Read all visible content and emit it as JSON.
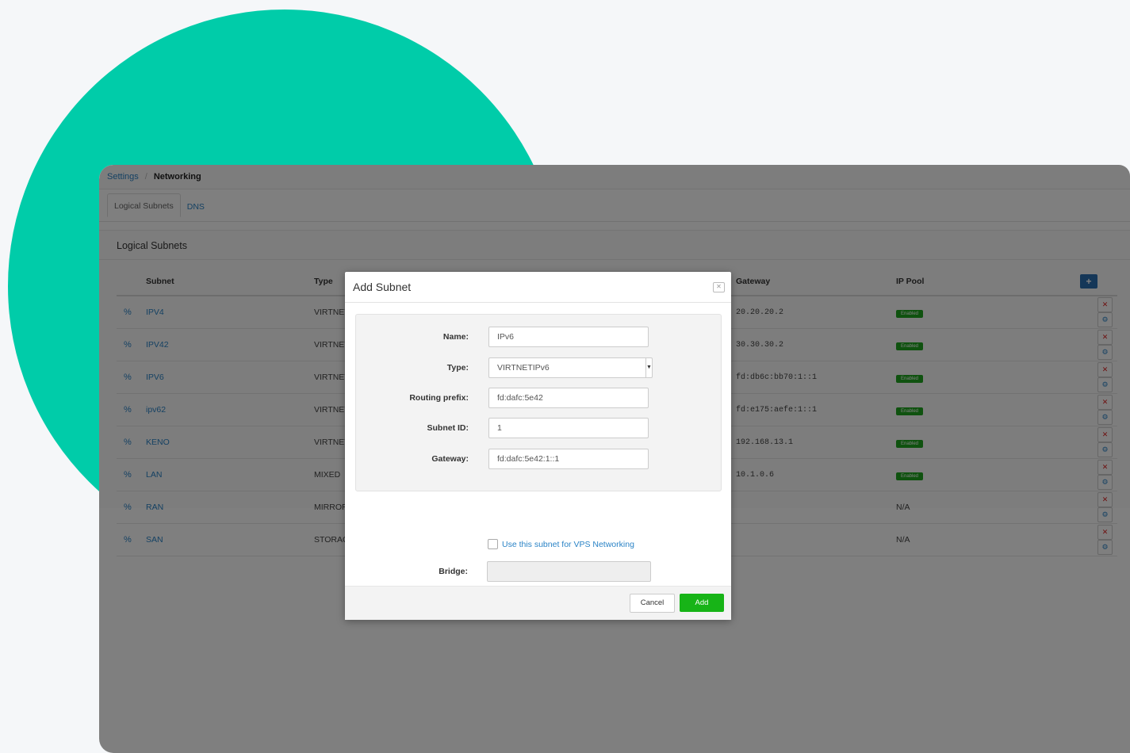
{
  "breadcrumb": {
    "parent": "Settings",
    "current": "Networking"
  },
  "tabs": [
    {
      "label": "Logical Subnets",
      "active": true
    },
    {
      "label": "DNS",
      "active": false
    }
  ],
  "section": {
    "title": "Logical Subnets"
  },
  "table": {
    "headers": {
      "subnet": "Subnet",
      "type": "Type",
      "gateway": "Gateway",
      "ip_pool": "IP Pool",
      "add_icon": "plus-icon"
    },
    "rows": [
      {
        "subnet": "IPV4",
        "type": "VIRTNET",
        "gateway": "20.20.20.2",
        "ip_pool": "Enabled"
      },
      {
        "subnet": "IPV42",
        "type": "VIRTNET",
        "gateway": "30.30.30.2",
        "ip_pool": "Enabled"
      },
      {
        "subnet": "IPV6",
        "type": "VIRTNET",
        "gateway": "fd:db6c:bb70:1::1",
        "ip_pool": "Enabled"
      },
      {
        "subnet": "ipv62",
        "type": "VIRTNET",
        "gateway": "fd:e175:aefe:1::1",
        "ip_pool": "Enabled"
      },
      {
        "subnet": "KENO",
        "type": "VIRTNET",
        "gateway": "192.168.13.1",
        "ip_pool": "Enabled"
      },
      {
        "subnet": "LAN",
        "type": "MIXED",
        "gateway": "10.1.0.6",
        "ip_pool": "Enabled"
      },
      {
        "subnet": "RAN",
        "type": "MIRROR",
        "gateway": "",
        "ip_pool": "N/A"
      },
      {
        "subnet": "SAN",
        "type": "STORAGE",
        "gateway": "",
        "ip_pool": "N/A"
      }
    ]
  },
  "modal": {
    "title": "Add Subnet",
    "fields": {
      "name": {
        "label": "Name:",
        "value": "IPv6"
      },
      "type": {
        "label": "Type:",
        "value": "VIRTNETIPv6"
      },
      "routing_prefix": {
        "label": "Routing prefix:",
        "value": "fd:dafc:5e42"
      },
      "subnet_id": {
        "label": "Subnet ID:",
        "value": "1"
      },
      "gateway": {
        "label": "Gateway:",
        "value": "fd:dafc:5e42:1::1"
      }
    },
    "vps_checkbox_label": "Use this subnet for VPS Networking",
    "vps_checked": false,
    "bridge": {
      "label": "Bridge:",
      "value": ""
    },
    "cancel_label": "Cancel",
    "add_label": "Add"
  },
  "colors": {
    "accent_circle": "#00cca9",
    "link": "#2a83c6",
    "enabled_badge": "#1fa51f",
    "add_button": "#17b417"
  }
}
